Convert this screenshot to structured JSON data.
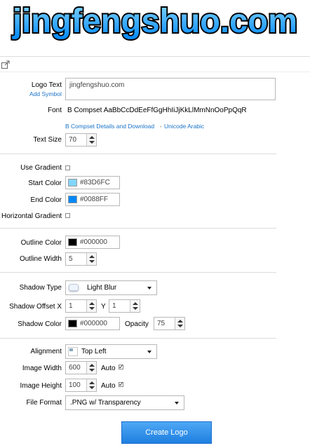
{
  "banner": {
    "text": "jingfengshuo.com"
  },
  "toolbar": {
    "share_icon": "share-icon"
  },
  "logo_text": {
    "label": "Logo Text",
    "value": "jingfengshuo.com",
    "add_symbol": "Add Symbol"
  },
  "font": {
    "label": "Font",
    "value": "B Compset AaBbCcDdEeFfGgHhIiJjKkLlMmNnOoPpQqR",
    "details_link": "B Compset Details and Download",
    "separator": "-",
    "unicode_link": "Unicode Arabic"
  },
  "text_size": {
    "label": "Text Size",
    "value": "70"
  },
  "gradient": {
    "use_label": "Use Gradient",
    "use_checked": false,
    "start_label": "Start Color",
    "start_color": "#83D6FC",
    "end_label": "End Color",
    "end_color": "#0088FF",
    "horizontal_label": "Horizontal Gradient",
    "horizontal_checked": false
  },
  "outline": {
    "color_label": "Outline Color",
    "color": "#000000",
    "width_label": "Outline Width",
    "width": "5"
  },
  "shadow": {
    "type_label": "Shadow Type",
    "type_value": "Light Blur",
    "offset_label": "Shadow Offset X",
    "offset_x": "1",
    "y_label": "Y",
    "offset_y": "1",
    "color_label": "Shadow Color",
    "color": "#000000",
    "opacity_label": "Opacity",
    "opacity": "75"
  },
  "alignment": {
    "label": "Alignment",
    "value": "Top Left"
  },
  "image_width": {
    "label": "Image Width",
    "value": "600",
    "auto_label": "Auto",
    "auto_checked": true
  },
  "image_height": {
    "label": "Image Height",
    "value": "100",
    "auto_label": "Auto",
    "auto_checked": true
  },
  "file_format": {
    "label": "File Format",
    "value": ".PNG w/ Transparency"
  },
  "create_button": "Create Logo",
  "colors": {
    "accent": "#1f7fe0",
    "link": "#1a73c8",
    "banner_fill_top": "#83D6FC",
    "banner_fill_bottom": "#0088FF"
  }
}
